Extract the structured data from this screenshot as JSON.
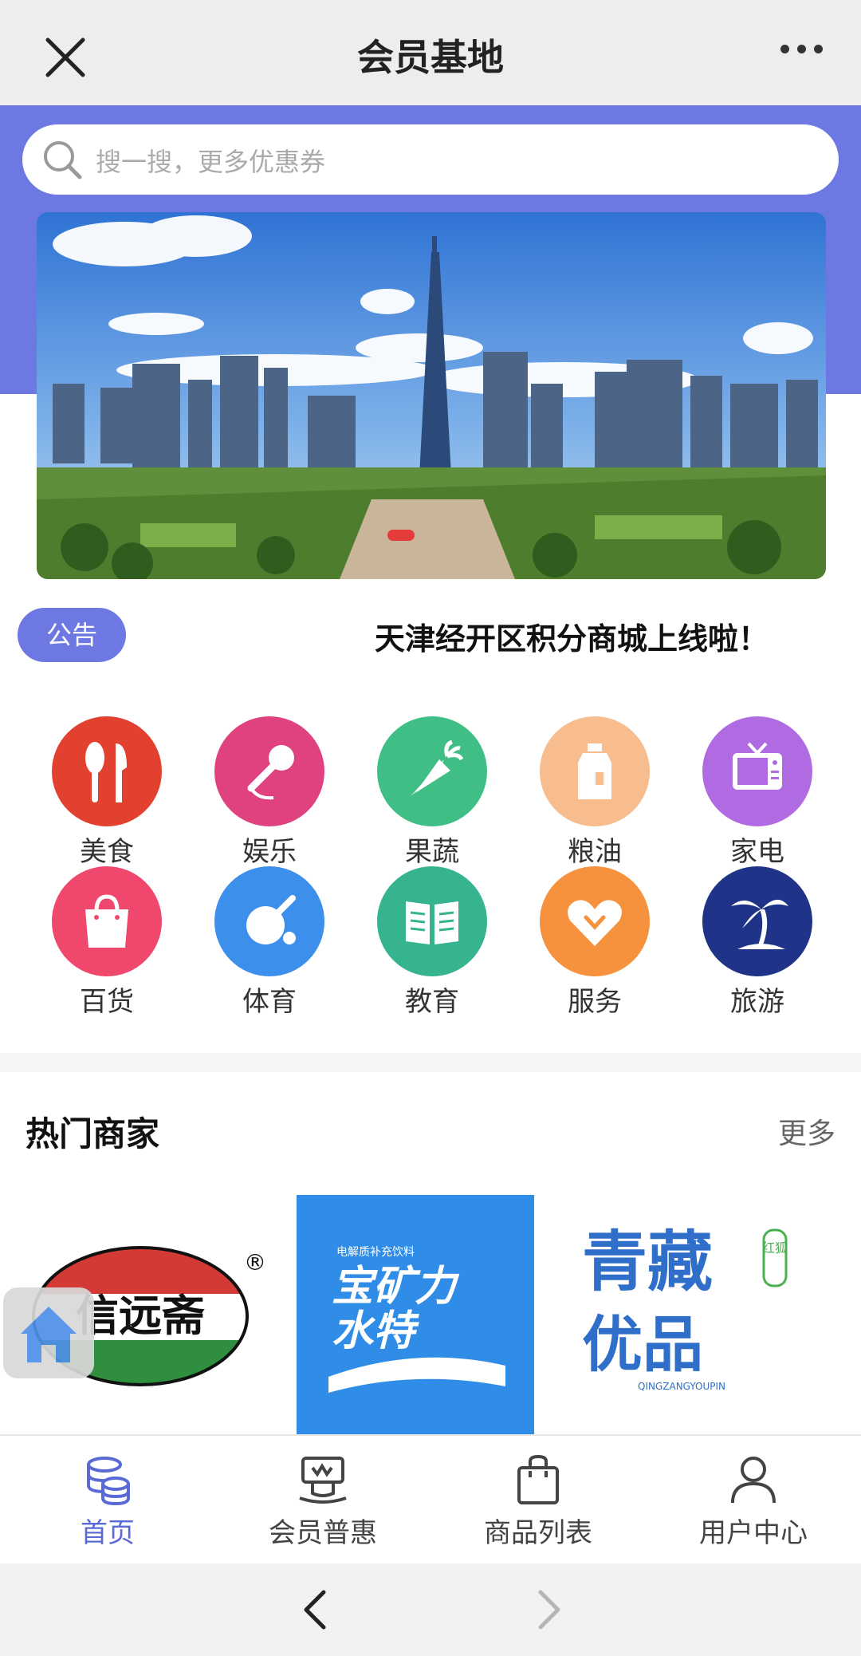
{
  "window": {
    "title": "会员基地"
  },
  "search": {
    "placeholder": "搜一搜，更多优惠券"
  },
  "notice": {
    "badge": "公告",
    "text": "天津经开区积分商城上线啦！"
  },
  "categories": [
    {
      "label": "美食",
      "icon": "fork-spoon-icon",
      "color": "#e2412f"
    },
    {
      "label": "娱乐",
      "icon": "microphone-icon",
      "color": "#e0427f"
    },
    {
      "label": "果蔬",
      "icon": "carrot-icon",
      "color": "#3fbf86"
    },
    {
      "label": "粮油",
      "icon": "oil-bottle-icon",
      "color": "#f7bd8e"
    },
    {
      "label": "家电",
      "icon": "tv-icon",
      "color": "#b06be3"
    },
    {
      "label": "百货",
      "icon": "shopping-bag-icon",
      "color": "#f0476d"
    },
    {
      "label": "体育",
      "icon": "ping-pong-icon",
      "color": "#3d8fec"
    },
    {
      "label": "教育",
      "icon": "book-icon",
      "color": "#35b48f"
    },
    {
      "label": "服务",
      "icon": "heart-icon",
      "color": "#f6913d"
    },
    {
      "label": "旅游",
      "icon": "palm-tree-icon",
      "color": "#1f3489"
    }
  ],
  "hot": {
    "title": "热门商家",
    "more": "更多"
  },
  "merchants": [
    {
      "name": "信远斋",
      "mark": "®"
    },
    {
      "subtitle": "电解质补充饮料",
      "line1": "宝矿力",
      "line2": "水特"
    },
    {
      "line1": "青藏",
      "line2": "优品",
      "sub": "QINGZANGYOUPIN",
      "seal": "红狐"
    }
  ],
  "bottomnav": [
    {
      "label": "首页",
      "icon": "coins-icon",
      "active": true
    },
    {
      "label": "会员普惠",
      "icon": "vip-icon",
      "active": false
    },
    {
      "label": "商品列表",
      "icon": "bag-icon",
      "active": false
    },
    {
      "label": "用户中心",
      "icon": "user-icon",
      "active": false
    }
  ],
  "colors": {
    "accent": "#6d78e3",
    "nav_active": "#5a6ad4"
  }
}
